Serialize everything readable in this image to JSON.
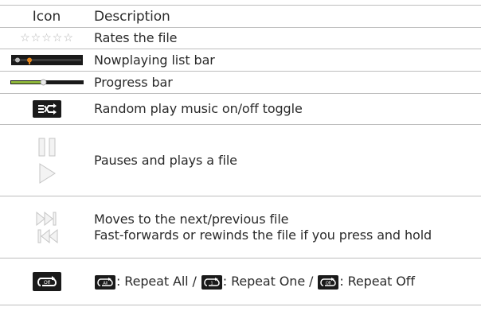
{
  "header": {
    "icon_col": "Icon",
    "desc_col": "Description"
  },
  "rows": [
    {
      "desc": "Rates the file",
      "icon": "rating-stars-icon"
    },
    {
      "desc": "Nowplaying list bar",
      "icon": "nowplaying-list-bar-icon"
    },
    {
      "desc": "Progress bar",
      "icon": "progress-bar-icon"
    },
    {
      "desc": "Random play music on/off toggle",
      "icon": "shuffle-toggle-icon"
    },
    {
      "desc": "Pauses and plays a file",
      "icon": "pause-play-icon"
    },
    {
      "desc_line1": "Moves to the next/previous file",
      "desc_line2": "Fast-forwards or rewinds the file if you press and hold",
      "icon": "next-previous-icon"
    },
    {
      "icon": "repeat-toggle-icon",
      "repeat_all_badge": "All",
      "repeat_all_text": ": Repeat All / ",
      "repeat_one_badge": "1",
      "repeat_one_text": ": Repeat One / ",
      "repeat_off_badge": "Off",
      "repeat_off_text": ": Repeat Off",
      "icon_badge": "Off"
    }
  ],
  "progress_bar": {
    "level": 0.45
  },
  "colors": {
    "border": "#bdbdbd",
    "icon_dark": "#1a1a1a",
    "progress_green": "#8fb83a",
    "nowplaying_orange": "#e6861c"
  }
}
